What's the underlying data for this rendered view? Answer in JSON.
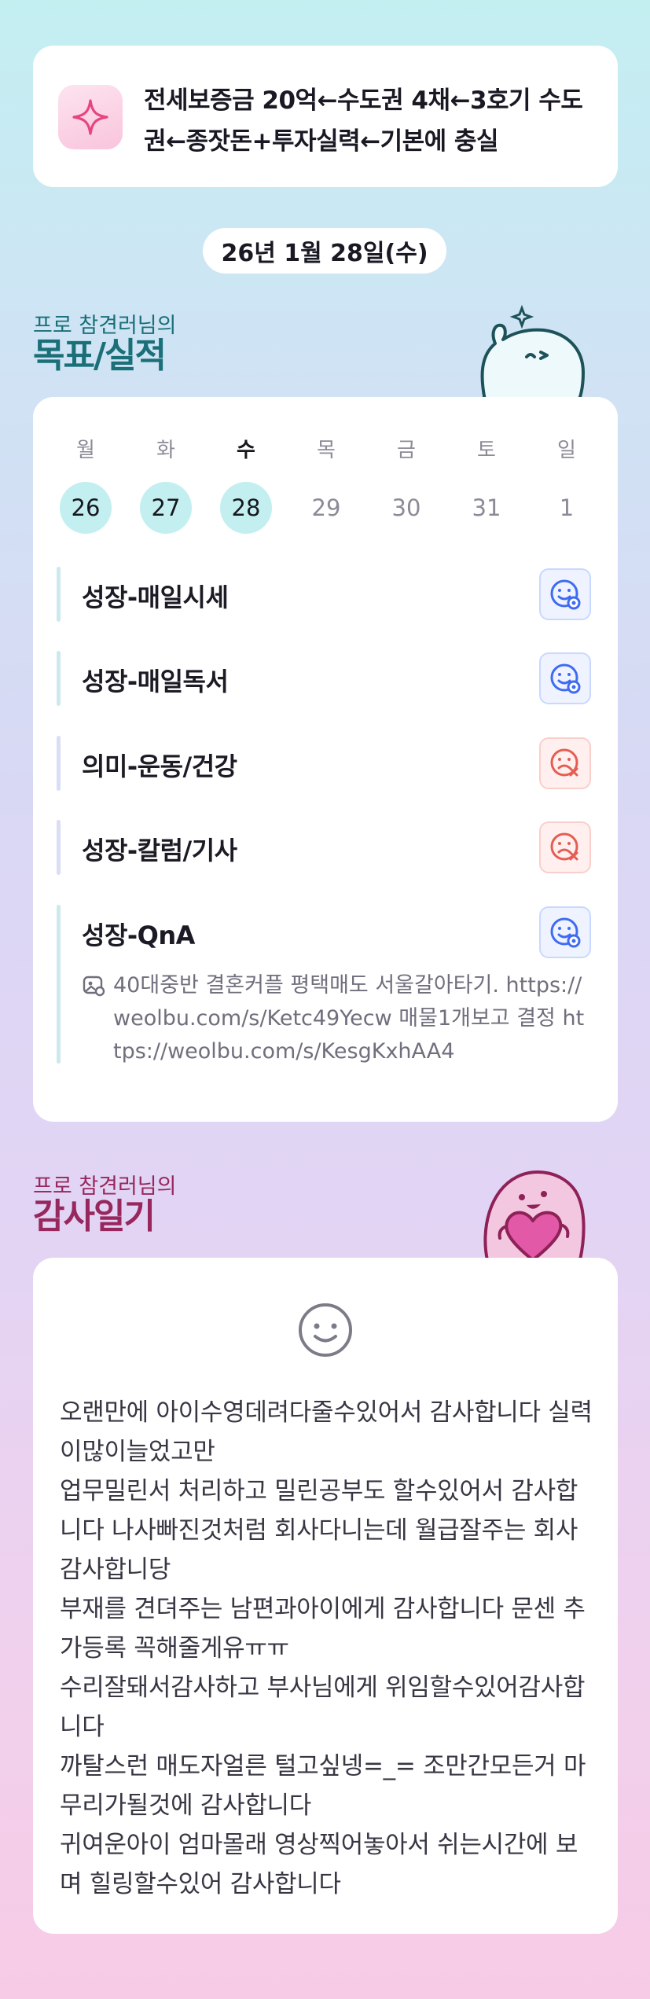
{
  "motto": {
    "icon": "sparkle-icon",
    "text": "전세보증금 20억←수도권 4채←3호기 수도권←종잣돈+투자실력←기본에 충실"
  },
  "date": "26년 1월 28일(수)",
  "goal_section": {
    "subtitle": "프로 참견러님의",
    "title": "목표/실적"
  },
  "week": [
    {
      "day": "월",
      "date": "26",
      "done": true
    },
    {
      "day": "화",
      "date": "27",
      "done": true
    },
    {
      "day": "수",
      "date": "28",
      "done": true,
      "today": true
    },
    {
      "day": "목",
      "date": "29",
      "done": false
    },
    {
      "day": "금",
      "date": "30",
      "done": false
    },
    {
      "day": "토",
      "date": "31",
      "done": false
    },
    {
      "day": "일",
      "date": "1",
      "done": false
    }
  ],
  "goals": [
    {
      "label": "성장-매일시세",
      "status": "done",
      "icon": "smile-check-icon"
    },
    {
      "label": "성장-매일독서",
      "status": "done",
      "icon": "smile-check-icon"
    },
    {
      "label": "의미-운동/건강",
      "status": "missed",
      "icon": "sad-x-icon"
    },
    {
      "label": "성장-칼럼/기사",
      "status": "missed",
      "icon": "sad-x-icon"
    },
    {
      "label": "성장-QnA",
      "status": "done",
      "icon": "smile-check-icon",
      "note": "40대중반 결혼커플 평택매도 서울갈아타기. https://weolbu.com/s/Ketc49Yecw 매물1개보고 결정 https://weolbu.com/s/KesgKxhAA4"
    }
  ],
  "thanks_section": {
    "subtitle": "프로 참견러님의",
    "title": "감사일기",
    "icon": "smile-icon",
    "text": "오랜만에 아이수영데려다줄수있어서 감사합니다 실력이많이늘었고만\n업무밀린서 처리하고 밀린공부도 할수있어서 감사합니다 나사빠진것처럼 회사다니는데 월급잘주는 회사감사합니당\n부재를 견뎌주는 남편과아이에게 감사합니다 문센 추가등록 꼭해줄게유ㅠㅠ\n수리잘돼서감사하고 부사님에게 위임할수있어감사합니다\n까탈스런 매도자얼른 털고싶넹=_= 조만간모든거 마무리가될것에 감사합니다\n귀여운아이 엄마몰래 영상찍어놓아서 쉬는시간에 보며 힐링할수있어 감사합니다"
  },
  "colors": {
    "goal_title": "#1a6f78",
    "thanks_title": "#97275d",
    "done_bg": "#c3eff1",
    "status_ok": "#3f6bf2",
    "status_bad": "#e55d52"
  }
}
